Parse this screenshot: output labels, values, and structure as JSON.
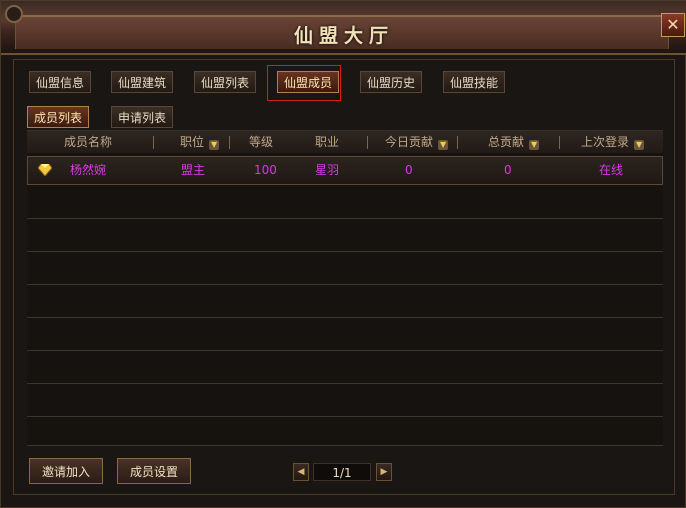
{
  "window": {
    "title": "仙盟大厅",
    "close_icon": "close-icon"
  },
  "tabs": [
    "仙盟信息",
    "仙盟建筑",
    "仙盟列表",
    "仙盟成员",
    "仙盟历史",
    "仙盟技能"
  ],
  "active_tab": "仙盟成员",
  "subtabs": [
    "成员列表",
    "申请列表"
  ],
  "active_subtab": "成员列表",
  "table": {
    "headers": [
      "成员名称",
      "职位",
      "等级",
      "职业",
      "今日贡献",
      "总贡献",
      "上次登录"
    ],
    "sortable_headers": [
      "职位",
      "今日贡献",
      "总贡献",
      "上次登录"
    ],
    "rows": [
      {
        "name": "杨然婉",
        "position": "盟主",
        "level": "100",
        "class": "星羽",
        "today_contribution": "0",
        "total_contribution": "0",
        "last_login": "在线"
      }
    ]
  },
  "footer": {
    "invite_button": "邀请加入",
    "settings_button": "成员设置",
    "page_indicator": "1/1"
  },
  "colors": {
    "member_name": "#d73ae6",
    "accent": "#d81c1c",
    "title": "#f2e2b8"
  }
}
